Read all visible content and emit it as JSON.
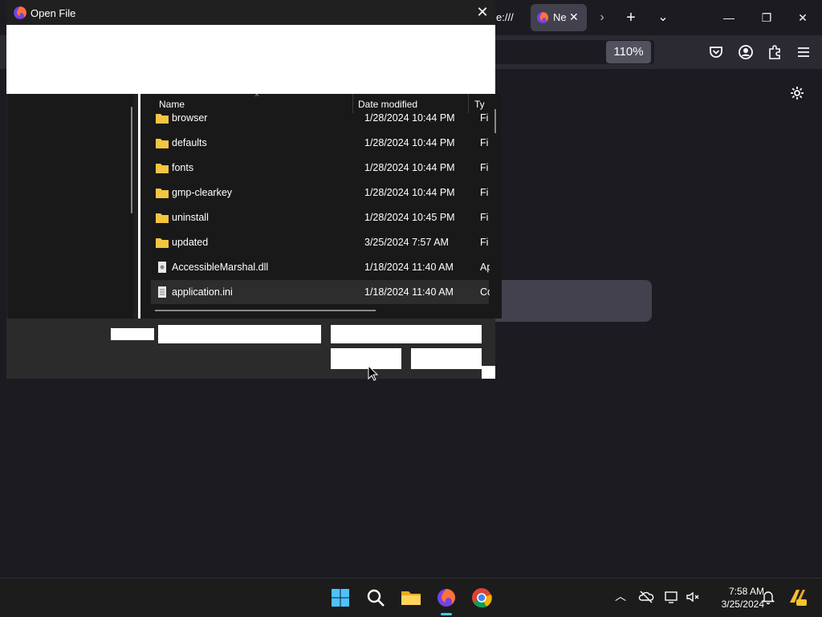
{
  "browser": {
    "tab_partial_text": "e:///",
    "active_tab_title": "Ne",
    "zoom": "110%"
  },
  "dialog": {
    "title": "Open File",
    "columns": {
      "name": "Name",
      "date": "Date modified",
      "type": "Ty"
    },
    "files": [
      {
        "name": "browser",
        "date": "1/28/2024 10:44 PM",
        "type": "Fi",
        "kind": "folder"
      },
      {
        "name": "defaults",
        "date": "1/28/2024 10:44 PM",
        "type": "Fi",
        "kind": "folder"
      },
      {
        "name": "fonts",
        "date": "1/28/2024 10:44 PM",
        "type": "Fi",
        "kind": "folder"
      },
      {
        "name": "gmp-clearkey",
        "date": "1/28/2024 10:44 PM",
        "type": "Fi",
        "kind": "folder"
      },
      {
        "name": "uninstall",
        "date": "1/28/2024 10:45 PM",
        "type": "Fi",
        "kind": "folder"
      },
      {
        "name": "updated",
        "date": "3/25/2024 7:57 AM",
        "type": "Fi",
        "kind": "folder"
      },
      {
        "name": "AccessibleMarshal.dll",
        "date": "1/18/2024 11:40 AM",
        "type": "Ap",
        "kind": "dll"
      },
      {
        "name": "application.ini",
        "date": "1/18/2024 11:40 AM",
        "type": "Co",
        "kind": "ini"
      }
    ]
  },
  "taskbar": {
    "time": "7:58 AM",
    "date": "3/25/2024"
  },
  "colors": {
    "accent": "#4cc2ff",
    "folder": "#f4c542",
    "firefox_bg": "#1c1b22"
  }
}
